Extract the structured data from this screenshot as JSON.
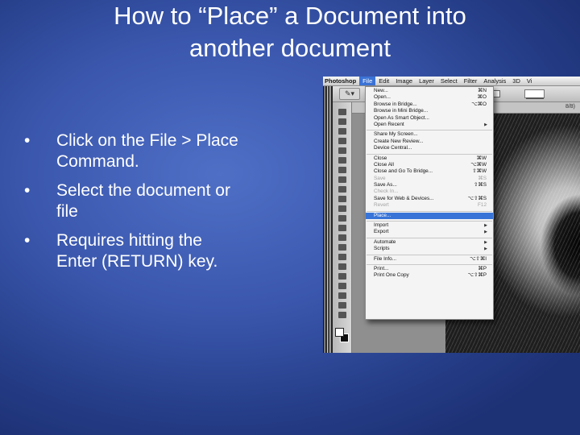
{
  "slide": {
    "title_line1": "How to “Place” a Document into",
    "title_line2": "another document",
    "bullet_symbol": "•",
    "bullets": [
      [
        "Click on the File > Place",
        "Command."
      ],
      [
        "Select the document or",
        "file"
      ],
      [
        "Requires hitting the",
        "Enter (RETURN) key."
      ]
    ]
  },
  "screenshot": {
    "menubar": [
      "Photoshop",
      "File",
      "Edit",
      "Image",
      "Layer",
      "Select",
      "Filter",
      "Analysis",
      "3D",
      "Vi"
    ],
    "doc_tab": "8/8)",
    "file_menu": [
      {
        "label": "New...",
        "shortcut": "⌘N",
        "disabled": false
      },
      {
        "label": "Open...",
        "shortcut": "⌘O",
        "disabled": false
      },
      {
        "label": "Browse in Bridge...",
        "shortcut": "⌥⌘O",
        "disabled": false
      },
      {
        "label": "Browse in Mini Bridge...",
        "shortcut": "",
        "disabled": false
      },
      {
        "label": "Open As Smart Object...",
        "shortcut": "",
        "disabled": false
      },
      {
        "label": "Open Recent",
        "shortcut": "",
        "disabled": false,
        "submenu": true
      },
      {
        "separator": true
      },
      {
        "label": "Share My Screen...",
        "shortcut": "",
        "disabled": false
      },
      {
        "label": "Create New Review...",
        "shortcut": "",
        "disabled": false
      },
      {
        "label": "Device Central...",
        "shortcut": "",
        "disabled": false
      },
      {
        "separator": true
      },
      {
        "label": "Close",
        "shortcut": "⌘W",
        "disabled": false
      },
      {
        "label": "Close All",
        "shortcut": "⌥⌘W",
        "disabled": false
      },
      {
        "label": "Close and Go To Bridge...",
        "shortcut": "⇧⌘W",
        "disabled": false
      },
      {
        "label": "Save",
        "shortcut": "⌘S",
        "disabled": true
      },
      {
        "label": "Save As...",
        "shortcut": "⇧⌘S",
        "disabled": false
      },
      {
        "label": "Check In...",
        "shortcut": "",
        "disabled": true
      },
      {
        "label": "Save for Web & Devices...",
        "shortcut": "⌥⇧⌘S",
        "disabled": false
      },
      {
        "label": "Revert",
        "shortcut": "F12",
        "disabled": true
      },
      {
        "separator": true
      },
      {
        "label": "Place...",
        "shortcut": "",
        "disabled": false,
        "highlighted": true
      },
      {
        "separator": true
      },
      {
        "label": "Import",
        "shortcut": "",
        "disabled": false,
        "submenu": true
      },
      {
        "label": "Export",
        "shortcut": "",
        "disabled": false,
        "submenu": true
      },
      {
        "separator": true
      },
      {
        "label": "Automate",
        "shortcut": "",
        "disabled": false,
        "submenu": true
      },
      {
        "label": "Scripts",
        "shortcut": "",
        "disabled": false,
        "submenu": true
      },
      {
        "separator": true
      },
      {
        "label": "File Info...",
        "shortcut": "⌥⇧⌘I",
        "disabled": false
      },
      {
        "separator": true
      },
      {
        "label": "Print...",
        "shortcut": "⌘P",
        "disabled": false
      },
      {
        "label": "Print One Copy",
        "shortcut": "⌥⇧⌘P",
        "disabled": false
      }
    ]
  }
}
